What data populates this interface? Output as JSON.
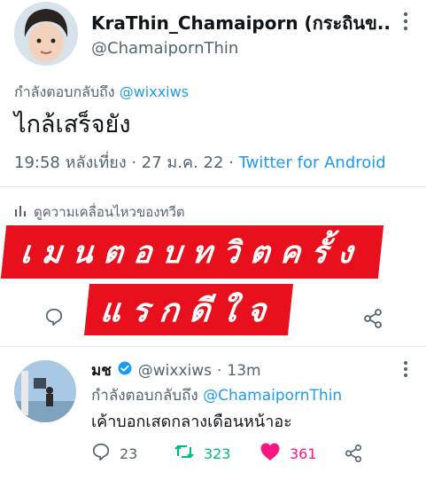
{
  "tweet": {
    "display_name": "KraThin_Chamaiporn (กระถินข...",
    "handle": "@ChamaipornThin",
    "replying_prefix": "กำลังตอบกลับถึง ",
    "replying_to": "@wixxiws",
    "text": "ไกล้เสร็จยัง",
    "timestamp": "19:58 หลังเที่ยง · 27 ม.ค. 22 · ",
    "source": "Twitter for Android",
    "activity_label": "ดูความเคลื่อนไหวของทวีต"
  },
  "overlay": {
    "banner_1": "เมนตอบทวิตครั้ง",
    "banner_2": "แรกดีใจ",
    "color": "#e8101c"
  },
  "reply": {
    "display_name": "มช",
    "handle": "@wixxiws",
    "separator": "·",
    "time": "13m",
    "replying_prefix": "กำลังตอบกลับถึง ",
    "replying_to": "@ChamaipornThin",
    "text": "เค้าบอกเสดกลางเดือนหน้าอะ",
    "replies": "23",
    "retweets": "323",
    "likes": "361"
  },
  "icons": {
    "more": "more-icon",
    "reply": "reply-icon",
    "share": "share-icon",
    "retweet": "retweet-icon",
    "like": "heart-icon",
    "verified": "verified-badge-icon",
    "activity": "bar-chart-icon"
  },
  "colors": {
    "accent": "#1d9bf0",
    "muted": "#536471",
    "retweet": "#00ba7c",
    "like": "#f91880"
  }
}
